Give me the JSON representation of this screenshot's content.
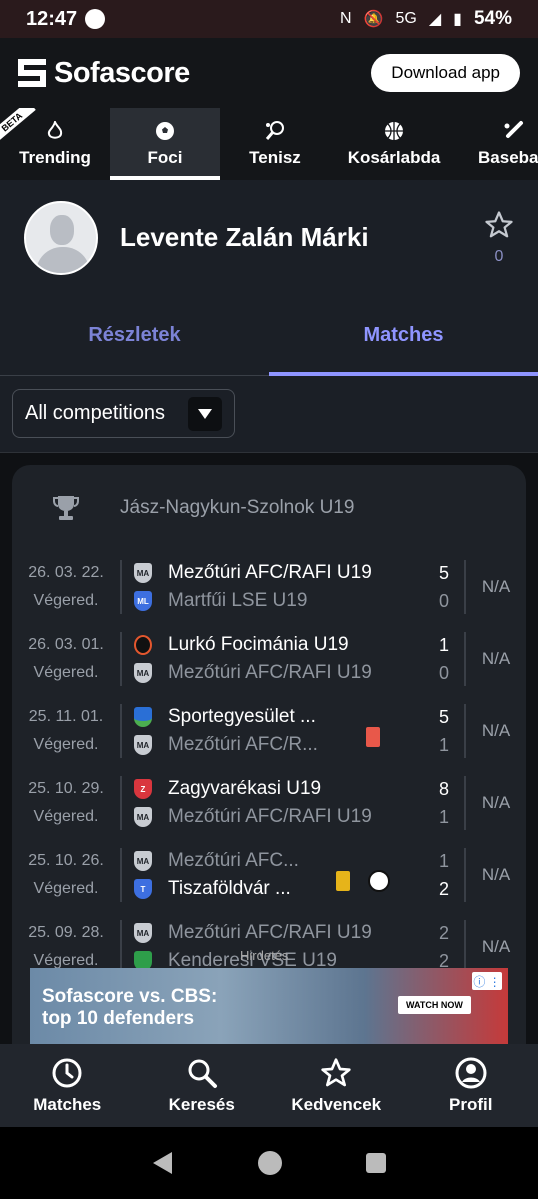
{
  "status_bar": {
    "time": "12:47",
    "network": "5G",
    "battery": "54%"
  },
  "header": {
    "logo_text": "Sofascore",
    "download_label": "Download app"
  },
  "sport_tabs": [
    {
      "label": "Trending",
      "icon": "flame-icon",
      "badge": "BETA"
    },
    {
      "label": "Foci",
      "icon": "soccer-ball-icon",
      "active": true
    },
    {
      "label": "Tenisz",
      "icon": "tennis-icon"
    },
    {
      "label": "Kosárlabda",
      "icon": "basketball-icon"
    },
    {
      "label": "Baseball",
      "icon": "baseball-icon"
    }
  ],
  "player": {
    "name": "Levente Zalán Márki",
    "followers": "0"
  },
  "detail_tabs": [
    {
      "label": "Részletek"
    },
    {
      "label": "Matches",
      "active": true
    }
  ],
  "filter": {
    "label": "All competitions"
  },
  "competition": {
    "name": "Jász-Nagykun-Szolnok U19"
  },
  "matches": [
    {
      "date": "26. 03. 22.",
      "status": "Végered.",
      "home": "Mezőtúri AFC/RAFI U19",
      "away": "Martfűi LSE U19",
      "home_score": "5",
      "away_score": "0",
      "rating": "N/A"
    },
    {
      "date": "26. 03. 01.",
      "status": "Végered.",
      "home": "Lurkó Focimánia U19",
      "away": "Mezőtúri AFC/RAFI U19",
      "home_score": "1",
      "away_score": "0",
      "rating": "N/A"
    },
    {
      "date": "25. 11. 01.",
      "status": "Végered.",
      "home": "Sportegyesület ...",
      "away": "Mezőtúri AFC/R...",
      "home_score": "5",
      "away_score": "1",
      "rating": "N/A"
    },
    {
      "date": "25. 10. 29.",
      "status": "Végered.",
      "home": "Zagyvarékasi U19",
      "away": "Mezőtúri AFC/RAFI U19",
      "home_score": "8",
      "away_score": "1",
      "rating": "N/A"
    },
    {
      "date": "25. 10. 26.",
      "status": "Végered.",
      "home": "Mezőtúri AFC...",
      "away": "Tiszaföldvár ...",
      "home_score": "1",
      "away_score": "2",
      "rating": "N/A"
    },
    {
      "date": "25. 09. 28.",
      "status": "Végered.",
      "home": "Mezőtúri AFC/RAFI U19",
      "away": "Kenderesi VSE U19",
      "home_score": "2",
      "away_score": "2",
      "rating": "N/A"
    }
  ],
  "ad": {
    "label": "Hirdetés",
    "text_line1": "Sofascore vs. CBS:",
    "text_line2": "top 10 defenders",
    "cta": "WATCH NOW"
  },
  "bottom_nav": [
    {
      "label": "Matches",
      "icon": "clock-icon"
    },
    {
      "label": "Keresés",
      "icon": "search-icon"
    },
    {
      "label": "Kedvencek",
      "icon": "star-icon"
    },
    {
      "label": "Profil",
      "icon": "profile-icon"
    }
  ],
  "colors": {
    "accent": "#8f95ff",
    "red_card": "#e8584a",
    "yellow_card": "#e6b41a"
  }
}
